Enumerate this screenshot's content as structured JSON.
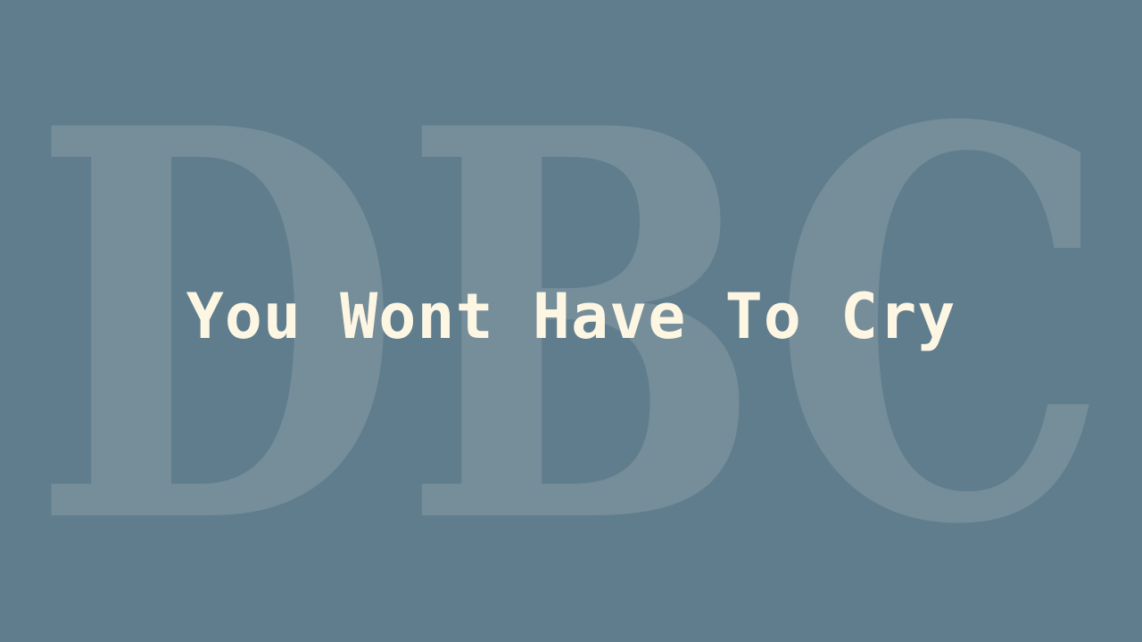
{
  "background_color": "#5f7d8d",
  "watermark": {
    "letters": "DBC",
    "color": "#768d9a"
  },
  "headline": {
    "text": "You Wont Have To Cry",
    "color": "#fdf6e3"
  }
}
